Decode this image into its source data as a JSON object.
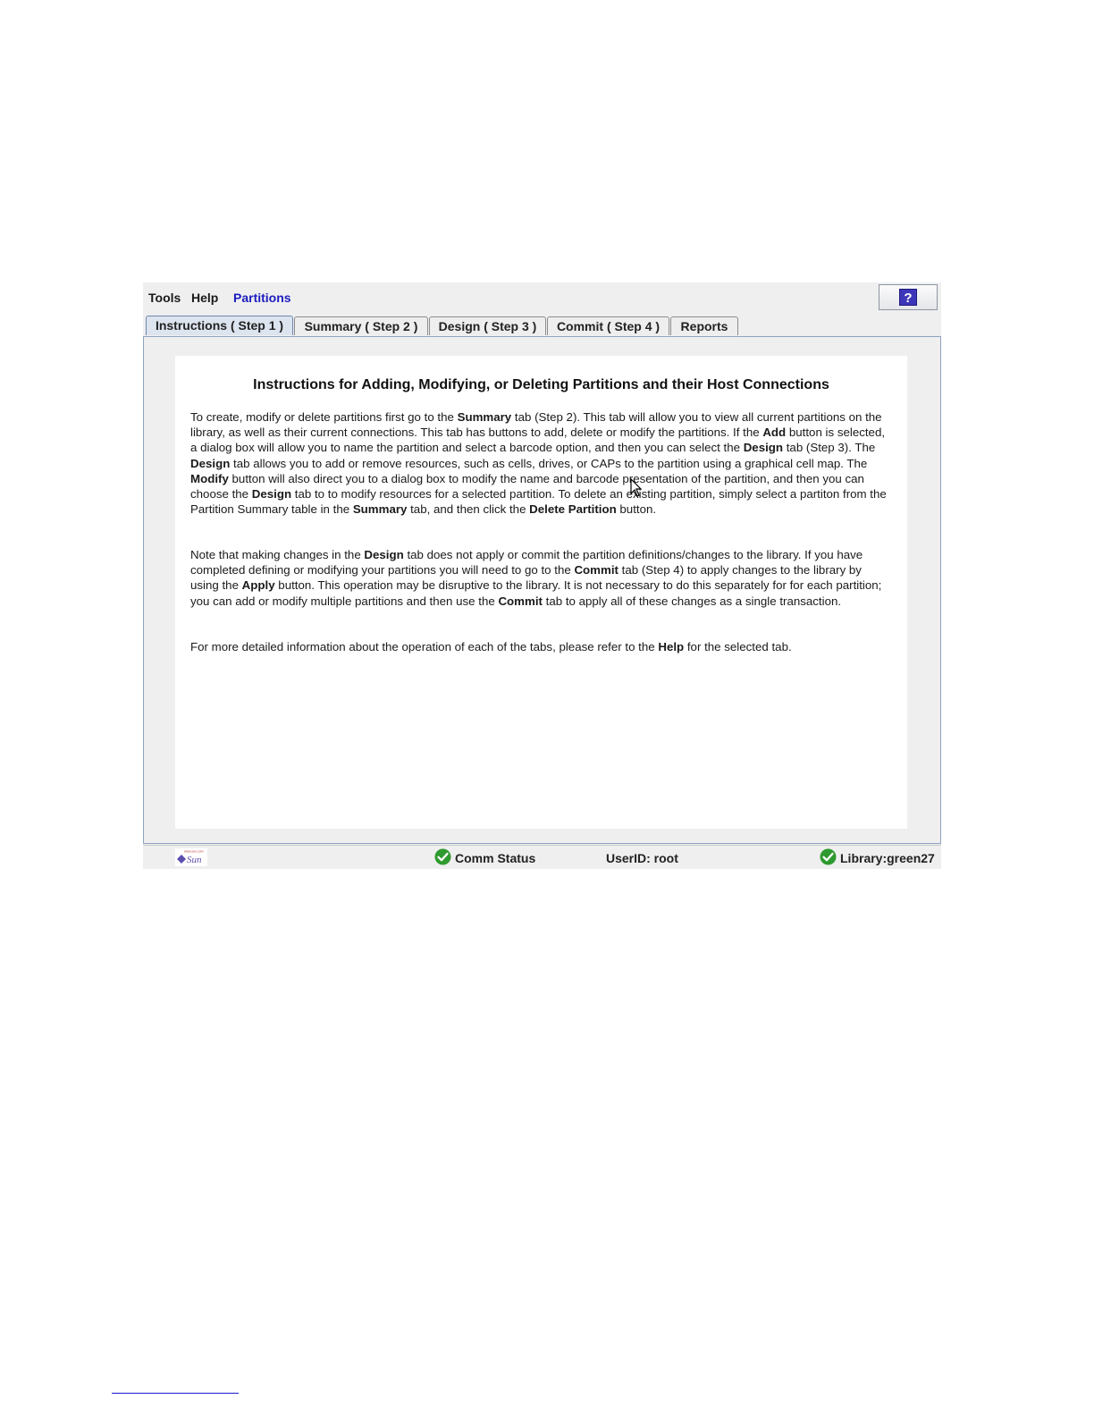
{
  "menu": {
    "tools": "Tools",
    "help": "Help",
    "partitions": "Partitions",
    "help_button_glyph": "?"
  },
  "tabs": [
    {
      "label": "Instructions ( Step 1 )",
      "selected": true
    },
    {
      "label": "Summary ( Step 2 )",
      "selected": false
    },
    {
      "label": "Design ( Step 3 )",
      "selected": false
    },
    {
      "label": "Commit ( Step 4 )",
      "selected": false
    },
    {
      "label": "Reports",
      "selected": false
    }
  ],
  "instructions": {
    "title": "Instructions for Adding, Modifying, or Deleting Partitions and their Host Connections",
    "para1": [
      {
        "t": "To create, modify or delete partitions first go to the "
      },
      {
        "t": "Summary",
        "b": true
      },
      {
        "t": " tab (Step 2). This tab will allow you to view all current partitions on the library, as well as their current connections. This tab has buttons to add, delete or modify the partitions. If the "
      },
      {
        "t": "Add",
        "b": true
      },
      {
        "t": " button is selected, a dialog box will allow you to name the partition and select a barcode option, and then you can select the "
      },
      {
        "t": "Design",
        "b": true
      },
      {
        "t": " tab (Step 3). The "
      },
      {
        "t": "Design",
        "b": true
      },
      {
        "t": " tab allows you to add or remove resources, such as cells, drives, or CAPs to the partition using a graphical cell map. The "
      },
      {
        "t": "Modify",
        "b": true
      },
      {
        "t": " button will also direct you to a dialog box to modify the name and barcode presentation of the partition, and then you can choose the "
      },
      {
        "t": "Design",
        "b": true
      },
      {
        "t": " tab to to modify resources for a selected partition. To delete an existing partition, simply select a partiton from the Partition Summary table in the "
      },
      {
        "t": "Summary",
        "b": true
      },
      {
        "t": " tab, and then click the "
      },
      {
        "t": "Delete Partition",
        "b": true
      },
      {
        "t": " button."
      }
    ],
    "para2": [
      {
        "t": "Note that making changes in the "
      },
      {
        "t": "Design",
        "b": true
      },
      {
        "t": " tab does not apply or commit the partition definitions/changes to the library. If you have completed defining or modifying your partitions you will need to go to the "
      },
      {
        "t": "Commit",
        "b": true
      },
      {
        "t": " tab (Step 4) to apply changes to the library by using the "
      },
      {
        "t": "Apply",
        "b": true
      },
      {
        "t": " button. This operation may be disruptive to the library. It is not necessary to do this separately for for each partition; you can add or modify multiple partitions and then use the "
      },
      {
        "t": "Commit",
        "b": true
      },
      {
        "t": " tab to apply all of these changes as a single transaction."
      }
    ],
    "para3": [
      {
        "t": "For more detailed information about the operation of each of the tabs, please refer to the "
      },
      {
        "t": "Help",
        "b": true
      },
      {
        "t": " for the selected tab."
      }
    ]
  },
  "status": {
    "logo_text": "Sun",
    "logo_small_text": "www.sun.com",
    "comm_status": "Comm Status",
    "user_id": "UserID: root",
    "library": "Library:green27"
  },
  "colors": {
    "accent_menu": "#1c1cc0",
    "check_green": "#2f9a2f",
    "tab_selected": "#dce4ef"
  }
}
